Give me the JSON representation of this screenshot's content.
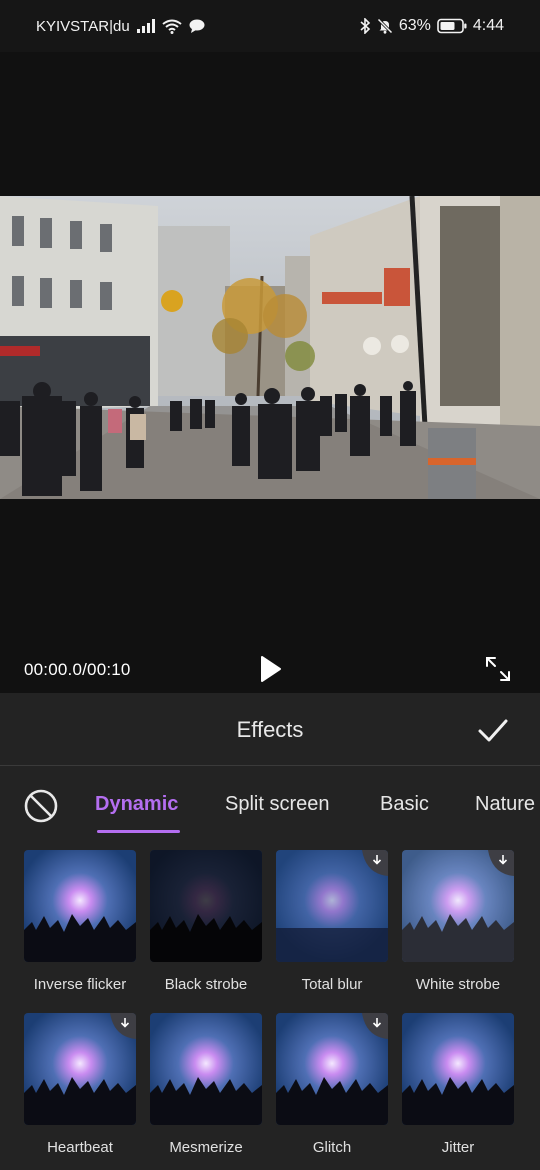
{
  "status_bar": {
    "carrier": "KYIVSTAR|du",
    "battery_percent": "63%",
    "time": "4:44",
    "icons": [
      "signal-icon",
      "wifi-icon",
      "message-icon",
      "bluetooth-icon",
      "mute-icon",
      "battery-icon"
    ]
  },
  "player": {
    "time": "00:00.0/00:10",
    "play_icon": "play-icon",
    "fullscreen_icon": "fullscreen-icon"
  },
  "panel": {
    "title": "Effects",
    "confirm_icon": "check-icon",
    "none_icon": "no-effect-icon"
  },
  "tabs": [
    {
      "label": "Dynamic",
      "active": true
    },
    {
      "label": "Split screen",
      "active": false
    },
    {
      "label": "Basic",
      "active": false
    },
    {
      "label": "Nature",
      "active": false
    }
  ],
  "effects": [
    {
      "label": "Inverse flicker",
      "downloadable": false
    },
    {
      "label": "Black strobe",
      "downloadable": false
    },
    {
      "label": "Total blur",
      "downloadable": true
    },
    {
      "label": "White strobe",
      "downloadable": true
    },
    {
      "label": "Heartbeat",
      "downloadable": true
    },
    {
      "label": "Mesmerize",
      "downloadable": false
    },
    {
      "label": "Glitch",
      "downloadable": true
    },
    {
      "label": "Jitter",
      "downloadable": false
    }
  ],
  "colors": {
    "accent": "#b46ef0",
    "panel": "#232323",
    "background": "#141414"
  }
}
